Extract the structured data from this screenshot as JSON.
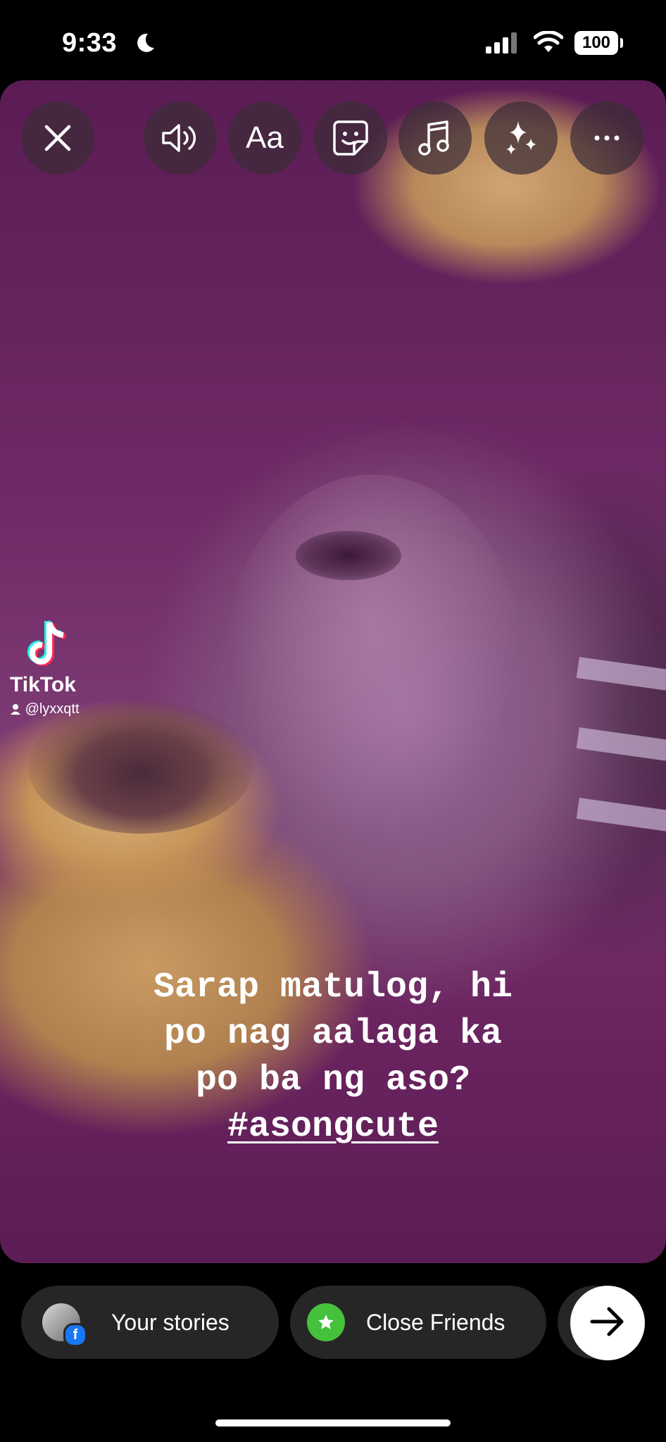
{
  "status_bar": {
    "time": "9:33",
    "battery": "100",
    "icons": [
      "moon-icon",
      "signal-icon",
      "wifi-icon",
      "battery-icon"
    ]
  },
  "toolbar": {
    "text_button_label": "Aa",
    "icons": [
      "close-icon",
      "speaker-icon",
      "text-icon",
      "sticker-icon",
      "music-icon",
      "effects-icon",
      "more-icon"
    ]
  },
  "watermark": {
    "brand": "TikTok",
    "username": "@lyxxqtt"
  },
  "caption": {
    "line1": "Sarap matulog, hi",
    "line2": "po nag aalaga ka",
    "line3": "po ba ng aso?",
    "hashtag": "#asongcute"
  },
  "bottom_bar": {
    "your_stories_label": "Your stories",
    "close_friends_label": "Close Friends",
    "facebook_badge": "f",
    "icons": [
      "avatar",
      "facebook-badge-icon",
      "star-icon",
      "arrow-right-icon"
    ]
  },
  "colors": {
    "overlay_bg": "#262626",
    "close_friends_green": "#45c13c",
    "facebook_blue": "#1877f2",
    "photo_tint": "#6e2a66"
  }
}
